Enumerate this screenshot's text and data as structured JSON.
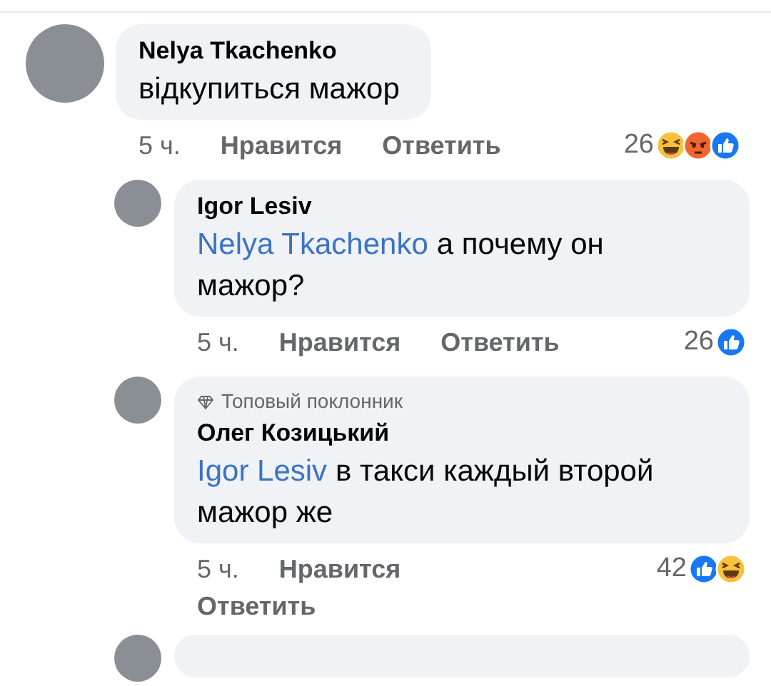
{
  "comments": [
    {
      "author": "Nelya Tkachenko",
      "text": "відкупиться мажор",
      "time": "5 ч.",
      "like": "Нравится",
      "reply": "Ответить",
      "count": "26",
      "reactions": [
        {
          "kind": "haha"
        },
        {
          "kind": "angry"
        },
        {
          "kind": "like"
        }
      ],
      "replies": [
        {
          "author": "Igor Lesiv",
          "mention": "Nelya Tkachenko",
          "text": "а почему он мажор?",
          "time": "5 ч.",
          "like": "Нравится",
          "reply": "Ответить",
          "count": "26",
          "reactions": [
            {
              "kind": "like"
            }
          ]
        },
        {
          "author": "Олег Козицький",
          "badge": "Топовый поклонник",
          "mention": "Igor Lesiv",
          "text": "в такси каждый второй мажор же",
          "time": "5 ч.",
          "like": "Нравится",
          "reply": "Ответить",
          "count": "42",
          "reactions": [
            {
              "kind": "like"
            },
            {
              "kind": "haha"
            }
          ]
        }
      ]
    }
  ]
}
